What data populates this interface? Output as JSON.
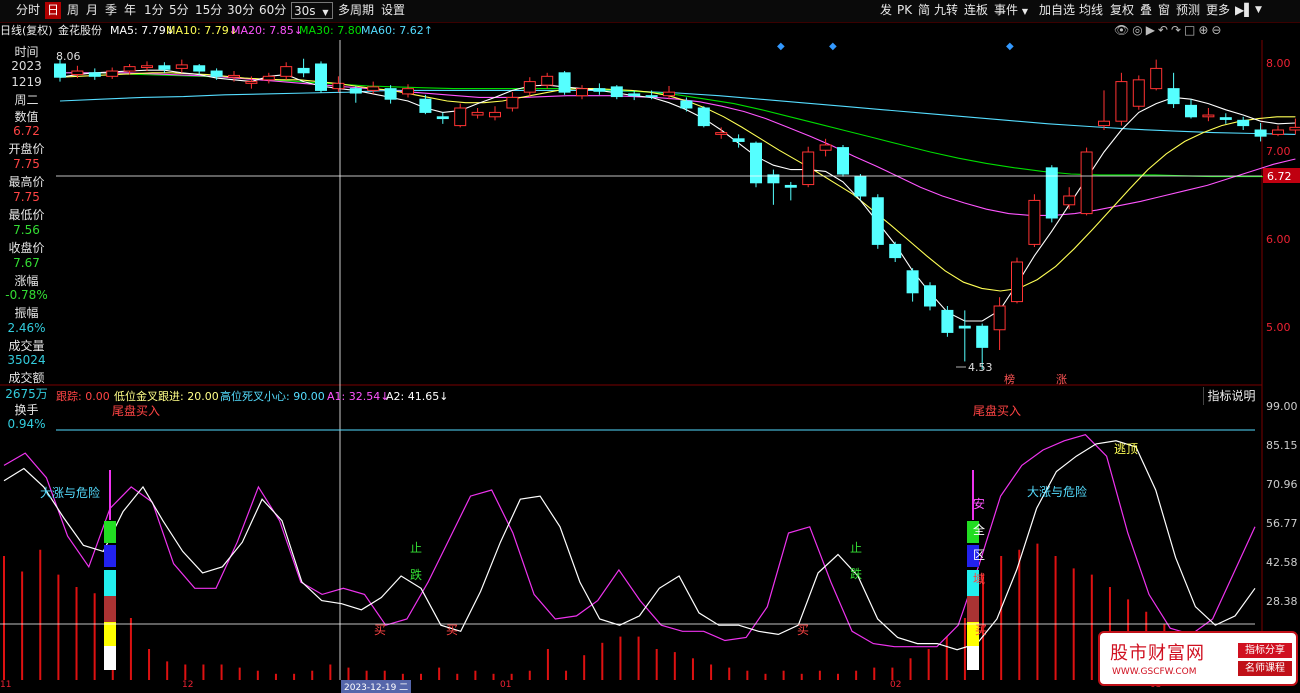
{
  "toolbar": {
    "period_tabs": [
      "分时",
      "日",
      "周",
      "月",
      "季",
      "年",
      "1分",
      "5分",
      "15分",
      "30分",
      "60分",
      "30s",
      "多周期",
      "设置"
    ],
    "active_tab": "日",
    "right_buttons": [
      "发",
      "PK",
      "简",
      "九转",
      "连板",
      "事件",
      "加自选",
      "均线",
      "复权",
      "叠",
      "窗",
      "预测",
      "更多"
    ]
  },
  "ma_row": {
    "chart_kind": "日线(复权)",
    "stock_name": "金花股份",
    "ma5_label": "MA5: 7.79↓",
    "ma10_label": "MA10: 7.79↓",
    "ma20_label": "MA20: 7.85↓",
    "ma30_label": "MA30: 7.80",
    "ma60_label": "MA60: 7.62↑",
    "colors": {
      "ma5": "#ffffff",
      "ma10": "#ffff55",
      "ma20": "#ff55ff",
      "ma30": "#00dd00",
      "ma60": "#55ddff"
    }
  },
  "info_panel": {
    "time_label": "时间",
    "year": "2023",
    "date": "1219",
    "weekday": "周二",
    "value_label": "数值",
    "value": "6.72",
    "open_label": "开盘价",
    "open": "7.75",
    "high_label": "最高价",
    "high": "7.75",
    "low_label": "最低价",
    "low": "7.56",
    "close_label": "收盘价",
    "close": "7.67",
    "change_label": "涨幅",
    "change": "-0.78%",
    "amplitude_label": "振幅",
    "amplitude": "2.46%",
    "volume_label": "成交量",
    "volume": "35024",
    "turnover_label": "成交额",
    "turnover": "2675万",
    "turnover_rate_label": "换手",
    "turnover_rate": "0.94%"
  },
  "price_axis": {
    "ticks": [
      "8.00",
      "7.00",
      "6.00",
      "5.00"
    ],
    "crosshair_value": "6.72"
  },
  "annotations": {
    "high_mark": "8.06",
    "low_mark": "4.53",
    "badge1": "榜",
    "badge2": "涨"
  },
  "indicator": {
    "legend": {
      "name": "跟踪: 0.00",
      "low_cross": "低位金叉跟进: 20.00",
      "high_cross": "高位死叉小心: 90.00",
      "a1": "A1: 32.54↓",
      "a2": "A2: 41.65↓"
    },
    "help_button": "指标说明",
    "axis": [
      "99.00",
      "85.15",
      "70.96",
      "56.77",
      "42.58",
      "28.38"
    ],
    "signals": {
      "buy_tail": "尾盘买入",
      "rise_danger": "大涨与危险",
      "stop": "止",
      "fall": "跌",
      "buy": "买",
      "escape_top": "逃顶",
      "safe_zone": [
        "安",
        "全",
        "区",
        "域"
      ]
    }
  },
  "date_axis": {
    "labels": [
      "11",
      "12",
      "2023-12-19 二",
      "01",
      "02",
      "03"
    ]
  },
  "watermark": {
    "title": "股市财富网",
    "url": "WWW.GSCFW.COM",
    "tag1": "指标分享",
    "tag2": "名师课程"
  },
  "chart_data": {
    "type": "candlestick",
    "price_range": [
      4.3,
      8.2
    ],
    "candles": [
      [
        8.0,
        7.85,
        8.06,
        7.8
      ],
      [
        7.88,
        7.92,
        7.98,
        7.84
      ],
      [
        7.9,
        7.86,
        7.95,
        7.82
      ],
      [
        7.86,
        7.92,
        7.96,
        7.83
      ],
      [
        7.92,
        7.97,
        8.0,
        7.88
      ],
      [
        7.96,
        7.98,
        8.03,
        7.92
      ],
      [
        7.98,
        7.94,
        8.02,
        7.9
      ],
      [
        7.95,
        7.99,
        8.05,
        7.9
      ],
      [
        7.98,
        7.92,
        8.0,
        7.88
      ],
      [
        7.92,
        7.86,
        7.95,
        7.82
      ],
      [
        7.85,
        7.87,
        7.92,
        7.8
      ],
      [
        7.78,
        7.8,
        7.86,
        7.72
      ],
      [
        7.82,
        7.86,
        7.9,
        7.78
      ],
      [
        7.86,
        7.97,
        8.02,
        7.82
      ],
      [
        7.95,
        7.9,
        8.06,
        7.85
      ],
      [
        8.0,
        7.7,
        8.03,
        7.67
      ],
      [
        7.72,
        7.78,
        7.86,
        7.68
      ],
      [
        7.72,
        7.67,
        7.75,
        7.56
      ],
      [
        7.7,
        7.74,
        7.8,
        7.66
      ],
      [
        7.72,
        7.6,
        7.76,
        7.55
      ],
      [
        7.66,
        7.72,
        7.77,
        7.62
      ],
      [
        7.6,
        7.45,
        7.65,
        7.43
      ],
      [
        7.4,
        7.38,
        7.45,
        7.32
      ],
      [
        7.3,
        7.5,
        7.55,
        7.28
      ],
      [
        7.42,
        7.45,
        7.5,
        7.38
      ],
      [
        7.4,
        7.45,
        7.52,
        7.36
      ],
      [
        7.5,
        7.62,
        7.68,
        7.46
      ],
      [
        7.68,
        7.8,
        7.85,
        7.63
      ],
      [
        7.76,
        7.86,
        7.9,
        7.72
      ],
      [
        7.9,
        7.68,
        7.92,
        7.65
      ],
      [
        7.64,
        7.72,
        7.76,
        7.6
      ],
      [
        7.72,
        7.69,
        7.78,
        7.65
      ],
      [
        7.74,
        7.63,
        7.76,
        7.6
      ],
      [
        7.66,
        7.64,
        7.7,
        7.59
      ],
      [
        7.64,
        7.63,
        7.7,
        7.6
      ],
      [
        7.64,
        7.68,
        7.75,
        7.6
      ],
      [
        7.58,
        7.5,
        7.62,
        7.46
      ],
      [
        7.5,
        7.3,
        7.52,
        7.28
      ],
      [
        7.2,
        7.22,
        7.28,
        7.15
      ],
      [
        7.15,
        7.12,
        7.2,
        7.05
      ],
      [
        7.1,
        6.65,
        7.12,
        6.6
      ],
      [
        6.74,
        6.65,
        6.8,
        6.4
      ],
      [
        6.62,
        6.6,
        6.66,
        6.45
      ],
      [
        6.63,
        7.0,
        7.06,
        6.6
      ],
      [
        7.02,
        7.08,
        7.15,
        6.95
      ],
      [
        7.05,
        6.75,
        7.08,
        6.72
      ],
      [
        6.72,
        6.5,
        6.75,
        6.45
      ],
      [
        6.48,
        5.95,
        6.52,
        5.9
      ],
      [
        5.95,
        5.8,
        5.98,
        5.75
      ],
      [
        5.65,
        5.4,
        5.68,
        5.3
      ],
      [
        5.48,
        5.25,
        5.52,
        5.2
      ],
      [
        5.2,
        4.95,
        5.25,
        4.9
      ],
      [
        5.02,
        5.0,
        5.2,
        4.62
      ],
      [
        5.02,
        4.78,
        5.05,
        4.53
      ],
      [
        4.98,
        5.25,
        5.35,
        4.75
      ],
      [
        5.3,
        5.75,
        5.8,
        5.28
      ],
      [
        5.95,
        6.45,
        6.52,
        5.92
      ],
      [
        6.82,
        6.25,
        6.85,
        6.2
      ],
      [
        6.4,
        6.5,
        6.6,
        6.35
      ],
      [
        6.3,
        7.0,
        7.05,
        6.28
      ],
      [
        7.3,
        7.35,
        7.7,
        7.25
      ],
      [
        7.35,
        7.8,
        7.9,
        7.3
      ],
      [
        7.52,
        7.82,
        7.87,
        7.48
      ],
      [
        7.72,
        7.95,
        8.05,
        7.7
      ],
      [
        7.72,
        7.55,
        7.9,
        7.5
      ],
      [
        7.53,
        7.4,
        7.6,
        7.38
      ],
      [
        7.4,
        7.42,
        7.5,
        7.35
      ],
      [
        7.39,
        7.37,
        7.44,
        7.32
      ],
      [
        7.36,
        7.3,
        7.4,
        7.25
      ],
      [
        7.25,
        7.18,
        7.33,
        7.12
      ],
      [
        7.2,
        7.25,
        7.3,
        7.18
      ],
      [
        7.25,
        7.28,
        7.38,
        7.2
      ]
    ],
    "ma5": [
      7.85,
      7.88,
      7.9,
      7.91,
      7.92,
      7.93,
      7.93,
      7.9,
      7.88,
      7.84,
      7.82,
      7.8,
      7.86,
      7.88,
      7.8,
      7.75,
      7.72,
      7.7,
      7.66,
      7.62,
      7.58,
      7.5,
      7.45,
      7.47,
      7.55,
      7.62,
      7.7,
      7.75,
      7.76,
      7.74,
      7.72,
      7.7,
      7.67,
      7.64,
      7.62,
      7.56,
      7.48,
      7.38,
      7.25,
      7.1,
      6.95,
      6.85,
      6.8,
      6.8,
      6.78,
      6.66,
      6.45,
      6.2,
      5.95,
      5.65,
      5.4,
      5.18,
      5.08,
      5.08,
      5.2,
      5.5,
      5.82,
      6.1,
      6.4,
      6.7,
      7.0,
      7.25,
      7.45,
      7.55,
      7.62,
      7.6,
      7.55,
      7.48,
      7.42,
      7.35,
      7.32,
      7.33
    ],
    "ma10": [
      7.85,
      7.86,
      7.87,
      7.88,
      7.89,
      7.9,
      7.9,
      7.89,
      7.88,
      7.86,
      7.84,
      7.83,
      7.82,
      7.82,
      7.8,
      7.78,
      7.75,
      7.72,
      7.7,
      7.66,
      7.62,
      7.58,
      7.56,
      7.56,
      7.58,
      7.62,
      7.66,
      7.7,
      7.72,
      7.72,
      7.71,
      7.7,
      7.68,
      7.64,
      7.58,
      7.5,
      7.4,
      7.28,
      7.15,
      7.02,
      6.9,
      6.78,
      6.65,
      6.52,
      6.35,
      6.18,
      6.0,
      5.82,
      5.65,
      5.52,
      5.45,
      5.42,
      5.45,
      5.55,
      5.7,
      5.9,
      6.12,
      6.35,
      6.58,
      6.8,
      6.98,
      7.12,
      7.22,
      7.3,
      7.35,
      7.38,
      7.4,
      7.4
    ],
    "ma20": [
      7.9,
      7.9,
      7.9,
      7.9,
      7.89,
      7.88,
      7.87,
      7.86,
      7.84,
      7.82,
      7.8,
      7.78,
      7.76,
      7.74,
      7.72,
      7.7,
      7.68,
      7.66,
      7.64,
      7.62,
      7.62,
      7.62,
      7.63,
      7.64,
      7.64,
      7.64,
      7.63,
      7.62,
      7.6,
      7.57,
      7.52,
      7.46,
      7.38,
      7.28,
      7.18,
      7.07,
      6.95,
      6.84,
      6.72,
      6.6,
      6.5,
      6.42,
      6.35,
      6.3,
      6.28,
      6.28,
      6.3,
      6.34,
      6.39,
      6.44,
      6.5,
      6.56,
      6.62,
      6.7,
      6.78,
      6.86,
      6.92
    ],
    "ma30": [
      7.9,
      7.9,
      7.89,
      7.88,
      7.87,
      7.86,
      7.85,
      7.83,
      7.81,
      7.79,
      7.77,
      7.75,
      7.74,
      7.73,
      7.72,
      7.72,
      7.72,
      7.72,
      7.72,
      7.71,
      7.7,
      7.68,
      7.65,
      7.6,
      7.55,
      7.48,
      7.4,
      7.32,
      7.24,
      7.16,
      7.08,
      7.0,
      6.93,
      6.87,
      6.82,
      6.78,
      6.75,
      6.74,
      6.74,
      6.74,
      6.73,
      6.72,
      6.72,
      6.72,
      6.72
    ],
    "ma60": [
      7.58,
      7.6,
      7.62,
      7.63,
      7.65,
      7.66,
      7.67,
      7.68,
      7.7,
      7.7,
      7.7,
      7.7,
      7.7,
      7.7,
      7.69,
      7.67,
      7.64,
      7.6,
      7.56,
      7.52,
      7.48,
      7.44,
      7.4,
      7.36,
      7.32,
      7.29,
      7.26,
      7.24,
      7.22,
      7.21,
      7.2
    ],
    "indicator_series": {
      "range": [
        15,
        99
      ],
      "white": [
        75,
        79,
        73,
        63,
        54,
        52,
        65,
        73,
        62,
        52,
        45,
        47,
        55,
        69,
        62,
        42,
        36,
        35,
        33,
        37,
        44,
        40,
        28,
        26,
        39,
        55,
        69,
        70,
        60,
        42,
        30,
        28,
        31,
        40,
        44,
        32,
        28,
        28,
        26,
        25,
        28,
        45,
        51,
        44,
        30,
        24,
        22,
        22,
        20,
        22,
        30,
        46,
        66,
        78,
        83,
        87,
        88,
        86,
        72,
        50,
        34,
        28,
        31,
        40
      ],
      "magenta": [
        80,
        84,
        76,
        57,
        47,
        66,
        73,
        68,
        48,
        40,
        40,
        55,
        73,
        62,
        42,
        38,
        40,
        38,
        28,
        30,
        42,
        56,
        70,
        72,
        58,
        38,
        30,
        31,
        36,
        46,
        36,
        28,
        26,
        26,
        23,
        24,
        34,
        58,
        60,
        42,
        26,
        22,
        21,
        21,
        21,
        28,
        48,
        70,
        80,
        85,
        88,
        90,
        83,
        58,
        38,
        27,
        25,
        30,
        45,
        60
      ],
      "volume_bars": [
        40,
        35,
        42,
        34,
        30,
        28,
        28,
        20,
        10,
        6,
        5,
        5,
        5,
        4,
        3,
        2,
        2,
        3,
        5,
        4,
        3,
        3,
        2,
        2,
        4,
        2,
        3,
        2,
        2,
        3,
        10,
        3,
        8,
        12,
        14,
        14,
        10,
        9,
        7,
        5,
        4,
        3,
        2,
        3,
        2,
        3,
        2,
        3,
        4,
        4,
        7,
        10,
        14,
        20,
        34,
        40,
        42,
        44,
        40,
        36,
        34,
        30,
        26,
        22,
        18,
        14,
        12,
        10,
        8,
        6
      ]
    }
  }
}
